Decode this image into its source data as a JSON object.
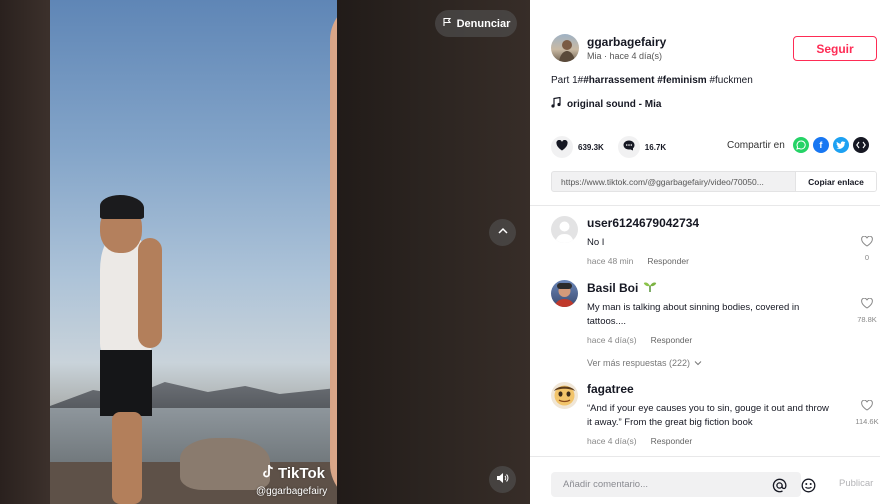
{
  "video": {
    "report_label": "Denunciar",
    "watermark_brand": "TikTok",
    "watermark_user": "@ggarbagefairy"
  },
  "author": {
    "username": "ggarbagefairy",
    "meta": "Mia · hace 4 día(s)",
    "follow_label": "Seguir"
  },
  "description": {
    "prefix": "Part 1#",
    "tag1": "#harrassement",
    "tag2": "#feminism",
    "tag3": "#fuckmen"
  },
  "music": {
    "label": "original sound - Mia"
  },
  "stats": {
    "likes": "639.3K",
    "comments": "16.7K"
  },
  "share": {
    "label": "Compartir en"
  },
  "link": {
    "url": "https://www.tiktok.com/@ggarbagefairy/video/70050...",
    "copy_label": "Copiar enlace"
  },
  "comments": [
    {
      "user": "user6124679042734",
      "text": "No I",
      "time": "hace 48 min",
      "reply": "Responder",
      "likes": "0"
    },
    {
      "user": "Basil Boi",
      "text": "My man is talking about sinning bodies, covered in tattoos....",
      "time": "hace 4 día(s)",
      "reply": "Responder",
      "likes": "78.8K"
    },
    {
      "user": "fagatree",
      "text": "“And if your eye causes you to sin, gouge it out and throw it away.” From the great big fiction book",
      "time": "hace 4 día(s)",
      "reply": "Responder",
      "likes": "114.6K"
    }
  ],
  "more_replies": "Ver más respuestas (222)",
  "bottom": {
    "placeholder": "Añadir comentario...",
    "publish": "Publicar"
  },
  "colors": {
    "accent": "#fe2c55",
    "whatsapp": "#25d366",
    "facebook": "#1877f2",
    "twitter": "#1da1f2"
  }
}
